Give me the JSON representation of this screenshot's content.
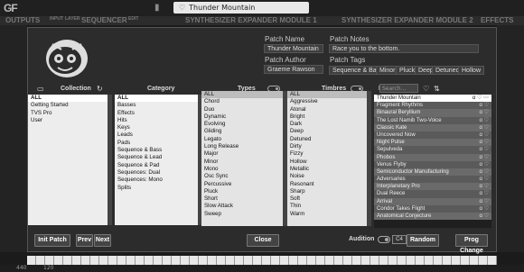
{
  "app": {
    "logo": "GF",
    "top_labels": [
      "OUTPUTS",
      "INPUT",
      "LAYER",
      "SEQUENCER",
      "EDIT",
      "SYNTHESIZER EXPANDER MODULE 1",
      "SYNTHESIZER EXPANDER MODULE 2",
      "EFFECTS"
    ],
    "search_value": "Thunder Mountain",
    "status": {
      "sample_rate": "440",
      "tempo": "120"
    }
  },
  "patch_info": {
    "name_label": "Patch Name",
    "name_value": "Thunder Mountain",
    "notes_label": "Patch Notes",
    "notes_value": "Race you to the bottom.",
    "author_label": "Patch Author",
    "author_value": "Graeme Rawson",
    "tags_label": "Patch Tags",
    "tags": [
      "Sequence & Bass",
      "Minor",
      "Pluck",
      "Deep",
      "Detuned",
      "Hollow"
    ]
  },
  "columns": {
    "collection": "Collection",
    "category": "Category",
    "types": "Types",
    "timbres": "Timbres",
    "patch": "Patch",
    "search_placeholder": "Search..."
  },
  "collection_items": [
    "ALL",
    "Getting Started",
    "TVS Pro",
    "User"
  ],
  "category_items": [
    "ALL",
    "Basses",
    "Effects",
    "Hits",
    "Keys",
    "Leads",
    "Pads",
    "Sequence & Bass",
    "Sequence & Lead",
    "Sequence & Pad",
    "Sequences: Dual",
    "Sequences: Mono",
    "Splits"
  ],
  "type_items": [
    "ALL",
    "Chord",
    "Duo",
    "Dynamic",
    "Evolving",
    "Gliding",
    "Legato",
    "Long Release",
    "Major",
    "Minor",
    "Mono",
    "Osc Sync",
    "Percussive",
    "Pluck",
    "Short",
    "Slow Attack",
    "Sweep"
  ],
  "timbre_items": [
    "ALL",
    "Aggressive",
    "Atonal",
    "Bright",
    "Dark",
    "Deep",
    "Detuned",
    "Dirty",
    "Fizzy",
    "Hollow",
    "Metallic",
    "Noise",
    "Resonant",
    "Sharp",
    "Soft",
    "Thin",
    "Warm"
  ],
  "patches": [
    "Thunder Mountain",
    "Fragment Rhythms",
    "Binaural Beryllium",
    "The Lost Namib Two-Voice",
    "Classic Kate",
    "Uncovered Now",
    "Night Pulse",
    "Sepulveda",
    "Phobos",
    "Venus Flyby",
    "Semiconductor Manufacturing",
    "Adversaries",
    "Interplanetary Pro",
    "Dual Reece",
    "Arrival",
    "Condor Takes Flight",
    "Anatomical Conjecture"
  ],
  "buttons": {
    "init": "Init Patch",
    "prev": "Prev",
    "next": "Next",
    "close": "Close",
    "audition": "Audition",
    "audition_note": "C4",
    "random": "Random",
    "prog_change": "Prog Change"
  }
}
